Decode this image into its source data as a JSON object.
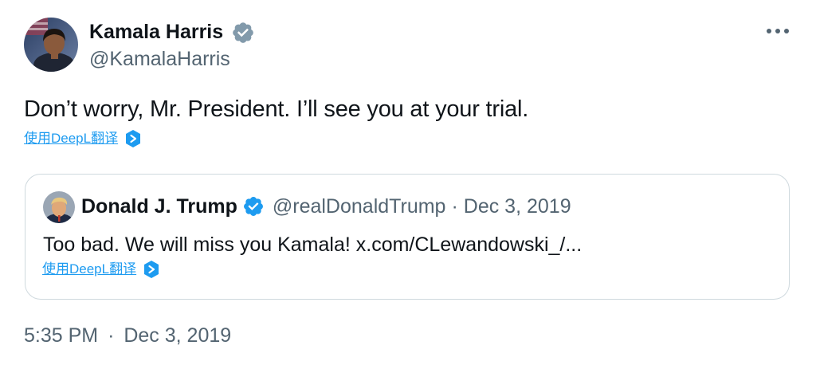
{
  "author": {
    "name": "Kamala Harris",
    "handle": "@KamalaHarris"
  },
  "tweet": {
    "text": "Don’t worry, Mr. President. I’ll see you at your trial.",
    "translate_label": "使用DeepL翻译",
    "more_icon": "more-horizontal-icon"
  },
  "quoted_tweet": {
    "author_name": "Donald J. Trump",
    "handle": "@realDonaldTrump",
    "separator": "·",
    "date": "Dec 3, 2019",
    "text": "Too bad. We will miss you Kamala! x.com/CLewandowski_/...",
    "translate_label": "使用DeepL翻译"
  },
  "timestamp": {
    "time": "5:35 PM",
    "separator": "·",
    "date": "Dec 3, 2019"
  },
  "colors": {
    "text": "#0f1419",
    "secondary": "#536471",
    "accent": "#1d9bf0",
    "border": "#cfd9de",
    "verified": "#829aab",
    "quote_verified": "#1d9bf0"
  }
}
